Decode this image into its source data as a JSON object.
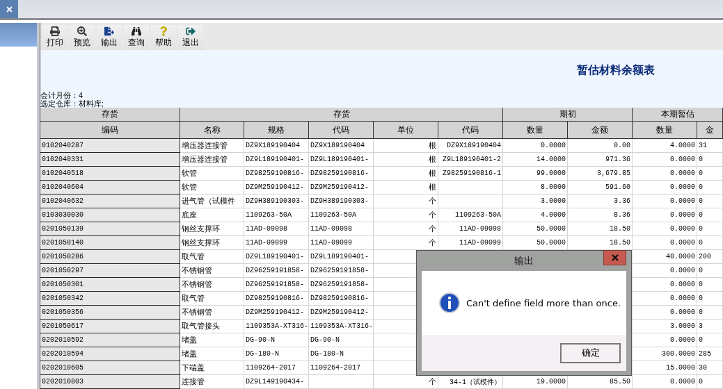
{
  "toolbar": {
    "buttons": [
      {
        "label": "打印"
      },
      {
        "label": "预览"
      },
      {
        "label": "输出"
      },
      {
        "label": "查询"
      },
      {
        "label": "帮助"
      },
      {
        "label": "退出"
      }
    ]
  },
  "report": {
    "title": "暂估材料余额表",
    "month": "会计月份：4",
    "warehouse": "选定仓库：材料库;"
  },
  "table": {
    "group_headers": [
      {
        "label": "存货",
        "columns": [
          "编码"
        ]
      },
      {
        "label": "存货",
        "columns": [
          "名称",
          "规格",
          "代码",
          "单位",
          "代码"
        ]
      },
      {
        "label": "期初",
        "columns": [
          "数量",
          "金额"
        ]
      },
      {
        "label": "本期暂估",
        "columns": [
          "数量",
          "金"
        ]
      }
    ],
    "rows": [
      {
        "code": "0102040287",
        "name": "增压器连接管",
        "spec": "DZ9X189190404",
        "code_2": "DZ9X189190404",
        "unit": "根",
        "code_3": "DZ9X189190404",
        "opening_qty": "0.0000",
        "opening_amount": "0.00",
        "estimate_qty": "4.0000",
        "estimate_amount": "31"
      },
      {
        "code": "0102040331",
        "name": "增压器连接管",
        "spec": "DZ9L189190401-",
        "code_2": "DZ9L189190401-",
        "unit": "根",
        "code_3": "Z9L189190401-2",
        "opening_qty": "14.0000",
        "opening_amount": "971.36",
        "estimate_qty": "0.0000",
        "estimate_amount": "0"
      },
      {
        "code": "0102040518",
        "name": "软管",
        "spec": "DZ98259190816-",
        "code_2": "DZ98259190816-",
        "unit": "根",
        "code_3": "Z98259190816-1",
        "opening_qty": "99.0000",
        "opening_amount": "3,679.85",
        "estimate_qty": "0.0000",
        "estimate_amount": "0"
      },
      {
        "code": "0102040604",
        "name": "软管",
        "spec": "DZ9M259190412-",
        "code_2": "DZ9M259190412-",
        "unit": "根",
        "opening_qty": "8.0000",
        "opening_amount": "591.60",
        "estimate_qty": "0.0000",
        "estimate_amount": "0"
      },
      {
        "code": "0102040632",
        "name": "进气管（试模件",
        "spec": "DZ9H389190303-",
        "code_2": "DZ9H389190303-",
        "unit": "个",
        "opening_qty": "3.0000",
        "opening_amount": "3.36",
        "estimate_qty": "0.0000",
        "estimate_amount": "0"
      },
      {
        "code": "0103030030",
        "name": "底座",
        "spec": "1109263-50A",
        "code_2": "1109263-50A",
        "unit": "个",
        "code_3": "1109263-50A",
        "opening_qty": "4.0000",
        "opening_amount": "8.36",
        "estimate_qty": "0.0000",
        "estimate_amount": "0"
      },
      {
        "code": "0201050139",
        "name": "钢丝支撑环",
        "spec": "11AD-09098",
        "code_2": "11AD-09098",
        "unit": "个",
        "code_3": "11AD-09098",
        "opening_qty": "50.0000",
        "opening_amount": "18.50",
        "estimate_qty": "0.0000",
        "estimate_amount": "0"
      },
      {
        "code": "0201050140",
        "name": "钢丝支撑环",
        "spec": "11AD-09099",
        "code_2": "11AD-09099",
        "unit": "个",
        "code_3": "11AD-09099",
        "opening_qty": "50.0000",
        "opening_amount": "18.50",
        "estimate_qty": "0.0000",
        "estimate_amount": "0"
      },
      {
        "code": "0201050286",
        "name": "取气管",
        "spec": "DZ9L189190401-",
        "code_2": "DZ9L189190401-",
        "estimate_qty": "40.0000",
        "estimate_amount": "200"
      },
      {
        "code": "0201050297",
        "name": "不锈钢管",
        "spec": "DZ96259191858-",
        "code_2": "DZ96259191858-",
        "estimate_qty": "0.0000",
        "estimate_amount": "0"
      },
      {
        "code": "0201050301",
        "name": "不锈钢管",
        "spec": "DZ96259191858-",
        "code_2": "DZ96259191858-",
        "estimate_qty": "0.0000",
        "estimate_amount": "0"
      },
      {
        "code": "0201050342",
        "name": "取气管",
        "spec": "DZ98259190816-",
        "code_2": "DZ98259190816-",
        "estimate_qty": "0.0000",
        "estimate_amount": "0"
      },
      {
        "code": "0201050356",
        "name": "不锈钢管",
        "spec": "DZ9M259190412-",
        "code_2": "DZ9M259190412-",
        "estimate_qty": "0.0000",
        "estimate_amount": "0"
      },
      {
        "code": "0201050617",
        "name": "取气管接头",
        "spec": "1109353A-XT316-",
        "code_2": "1109353A-XT316-",
        "estimate_qty": "3.0000",
        "estimate_amount": "3"
      },
      {
        "code": "0202010592",
        "name": "堵盖",
        "spec": "DG-90-N",
        "code_2": "DG-90-N",
        "estimate_qty": "0.0000",
        "estimate_amount": "0"
      },
      {
        "code": "0202010594",
        "name": "堵盖",
        "spec": "DG-180-N",
        "code_2": "DG-180-N",
        "estimate_qty": "300.0000",
        "estimate_amount": "285"
      },
      {
        "code": "0202010605",
        "name": "下端盖",
        "spec": "1109264-2017",
        "code_2": "1109264-2017",
        "estimate_qty": "15.0000",
        "estimate_amount": "30"
      },
      {
        "code": "0202010803",
        "name": "连接管",
        "spec": "DZ9L149190434-",
        "unit": "个",
        "code_3": "34-1（试模件）",
        "opening_qty": "19.0000",
        "opening_amount": "85.50",
        "estimate_qty": "0.0000",
        "estimate_amount": "0"
      }
    ]
  },
  "dialog": {
    "title": "输出",
    "message": "Can't define field more than once.",
    "button": "确定"
  }
}
